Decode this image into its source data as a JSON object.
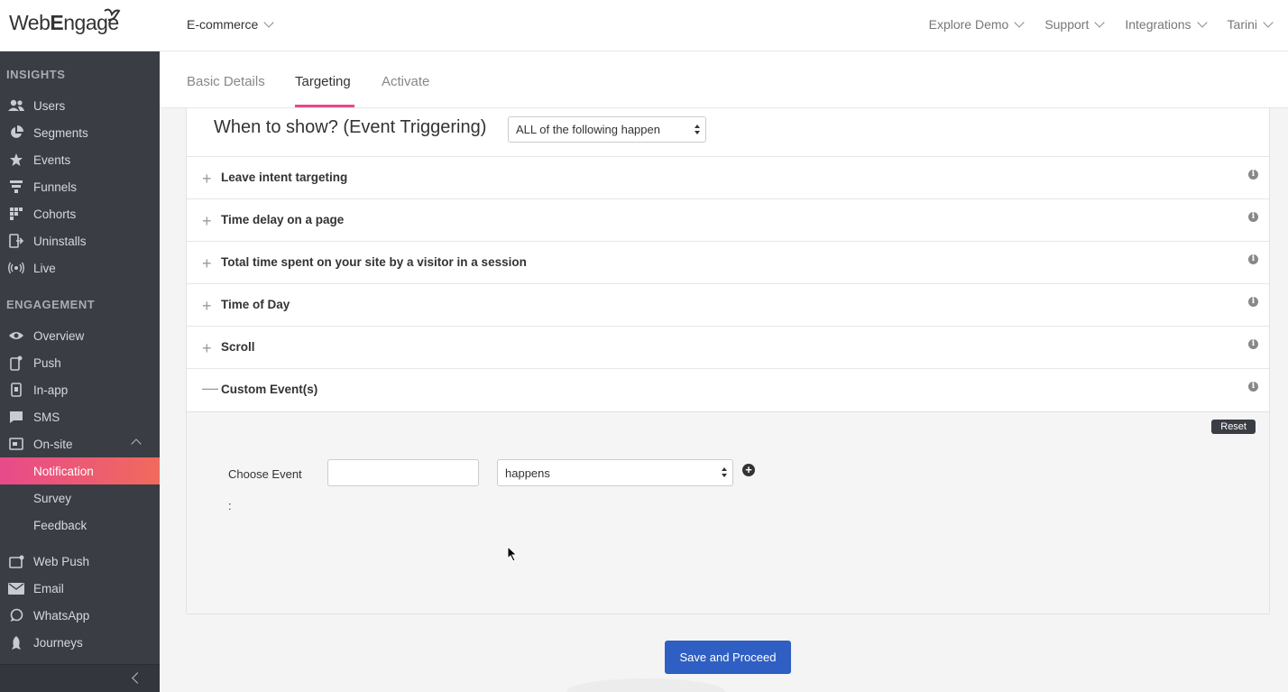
{
  "brand": {
    "logo_prefix": "Web",
    "logo_suffix": "ngage",
    "logo_cap": "E"
  },
  "header": {
    "project": "E-commerce",
    "nav": [
      "Explore Demo",
      "Support",
      "Integrations",
      "Tarini"
    ]
  },
  "sidebar": {
    "insights_title": "INSIGHTS",
    "insights": [
      "Users",
      "Segments",
      "Events",
      "Funnels",
      "Cohorts",
      "Uninstalls",
      "Live"
    ],
    "engagement_title": "ENGAGEMENT",
    "engagement": [
      "Overview",
      "Push",
      "In-app",
      "SMS",
      "On-site"
    ],
    "onsite_sub": [
      "Notification",
      "Survey",
      "Feedback"
    ],
    "more": [
      "Web Push",
      "Email",
      "WhatsApp",
      "Journeys"
    ]
  },
  "tabs": [
    "Basic Details",
    "Targeting",
    "Activate"
  ],
  "targeting": {
    "title": "When to show? (Event Triggering)",
    "condition": "ALL of the following happen",
    "rows": [
      "Leave intent targeting",
      "Time delay on a page",
      "Total time spent on your site by a visitor in a session",
      "Time of Day",
      "Scroll",
      "Custom Event(s)"
    ],
    "reset": "Reset",
    "choose_event": "Choose Event",
    "colon": ":",
    "event_value": "",
    "happens": "happens"
  },
  "save_button": "Save and Proceed",
  "colors": {
    "accent": "#e84a8a",
    "primary": "#2f5fc2",
    "sidebar": "#3a3d44"
  }
}
